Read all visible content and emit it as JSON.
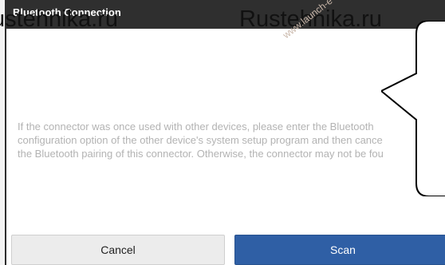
{
  "dialog": {
    "title": "Bluetooth Connection",
    "message_lines": [
      "If the connector was once used with other devices, please enter the Bluetooth",
      "configuration option of the other device's system setup program and then cance",
      "the Bluetooth pairing of this connector. Otherwise, the connector may not be fou"
    ],
    "buttons": {
      "cancel": "Cancel",
      "scan": "Scan"
    }
  },
  "watermarks": {
    "left": "ustehnika.ru",
    "right": "Rustehnika.ru",
    "diagonal": "www.launch-e"
  },
  "colors": {
    "title_bar": "#2f2f2f",
    "scan_button": "#2f5fa5",
    "cancel_button": "#ececec",
    "message_text": "#b3b3b3"
  }
}
